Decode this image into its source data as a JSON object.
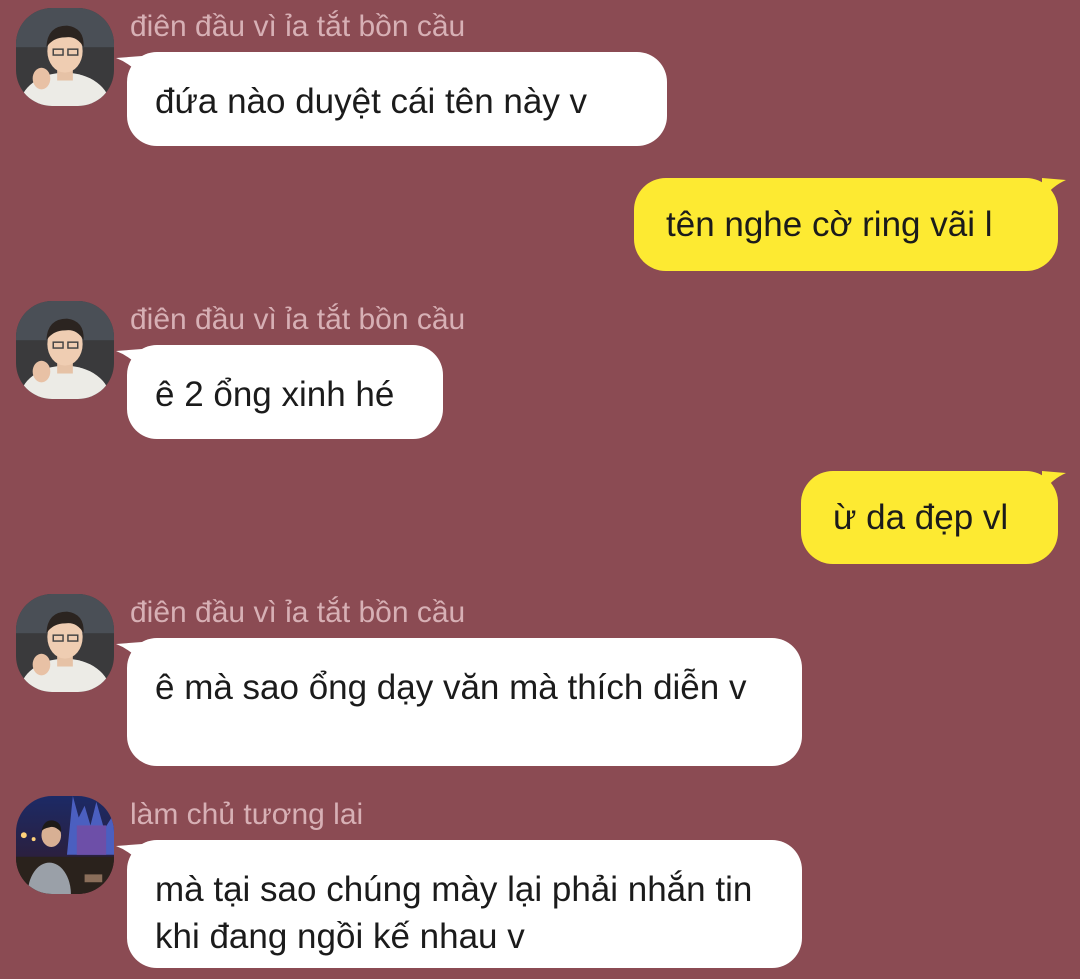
{
  "colors": {
    "background": "#8b4b53",
    "incoming_bubble": "#ffffff",
    "outgoing_bubble": "#fdea32",
    "sender_name": "#d7b0b5",
    "message_text": "#1b1b1b"
  },
  "messages": [
    {
      "direction": "incoming",
      "sender": "điên đầu vì ỉa tắt bồn cầu",
      "text": "đứa nào duyệt cái tên này v"
    },
    {
      "direction": "outgoing",
      "text": "tên nghe cờ ring vãi l"
    },
    {
      "direction": "incoming",
      "sender": "điên đầu vì ỉa tắt bồn cầu",
      "text": "ê 2 ổng xinh hé"
    },
    {
      "direction": "outgoing",
      "text": "ừ da đẹp vl"
    },
    {
      "direction": "incoming",
      "sender": "điên đầu vì ỉa tắt bồn cầu",
      "text": "ê mà sao ổng dạy văn mà thích diễn v"
    },
    {
      "direction": "incoming",
      "sender": "làm chủ tương lai",
      "text": "mà tại sao chúng mày lại phải nhắn tin khi đang ngồi kế nhau v"
    }
  ]
}
